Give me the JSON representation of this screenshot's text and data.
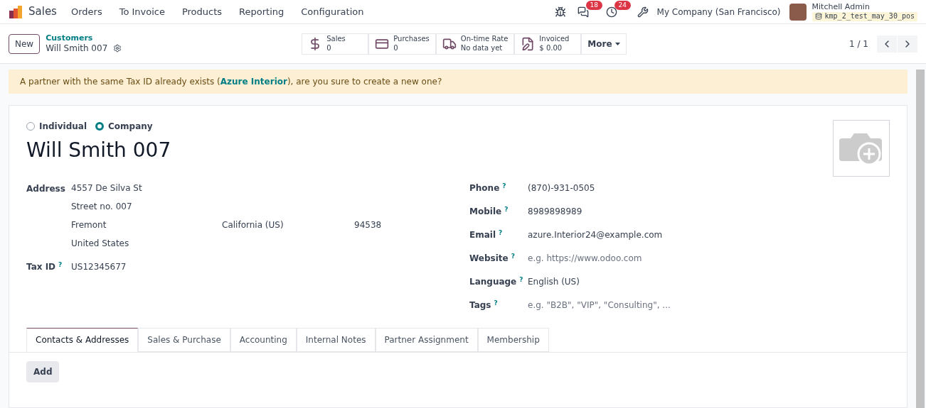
{
  "navbar": {
    "app": "Sales",
    "menu": [
      "Orders",
      "To Invoice",
      "Products",
      "Reporting",
      "Configuration"
    ],
    "messages_count": "18",
    "activities_count": "24",
    "company": "My Company (San Francisco)",
    "user": "Mitchell Admin",
    "database": "kmp_2_test_may_30_pos"
  },
  "control_panel": {
    "new_button": "New",
    "breadcrumb": "Customers",
    "record": "Will Smith 007",
    "pager": "1 / 1",
    "stat_buttons": [
      {
        "kind": "dollar",
        "label": "Sales",
        "value": "0"
      },
      {
        "kind": "card",
        "label": "Purchases",
        "value": "0"
      },
      {
        "kind": "truck",
        "label": "On-time Rate",
        "value": "No data yet"
      },
      {
        "kind": "invoice",
        "label": "Invoiced",
        "value": "$ 0.00"
      }
    ],
    "more_button": "More"
  },
  "warning": {
    "before": "A partner with the same Tax ID already exists (",
    "link": "Azure Interior",
    "after": "), are you sure to create a new one?"
  },
  "form": {
    "company_type": [
      {
        "label": "Individual",
        "selected": false
      },
      {
        "label": "Company",
        "selected": true
      }
    ],
    "name": "Will Smith 007",
    "address": {
      "label": "Address",
      "street": "4557 De Silva St",
      "street2": "Street no. 007",
      "city": "Fremont",
      "state": "California (US)",
      "zip": "94538",
      "country": "United States"
    },
    "tax_id": {
      "label": "Tax ID",
      "help": "?",
      "value": "US12345677"
    },
    "right_fields": [
      {
        "label": "Phone",
        "help": "?",
        "value": "(870)-931-0505"
      },
      {
        "label": "Mobile",
        "help": "?",
        "value": "8989898989"
      },
      {
        "label": "Email",
        "help": "?",
        "value": "azure.Interior24@example.com"
      },
      {
        "label": "Website",
        "help": "?",
        "placeholder": "e.g. https://www.odoo.com"
      },
      {
        "label": "Language",
        "help": "?",
        "value": "English (US)"
      },
      {
        "label": "Tags",
        "help": "?",
        "placeholder": "e.g. \"B2B\", \"VIP\", \"Consulting\", ..."
      }
    ],
    "tabs": [
      {
        "label": "Contacts & Addresses",
        "selected": true
      },
      {
        "label": "Sales & Purchase",
        "selected": false
      },
      {
        "label": "Accounting",
        "selected": false
      },
      {
        "label": "Internal Notes",
        "selected": false
      },
      {
        "label": "Partner Assignment",
        "selected": false
      },
      {
        "label": "Membership",
        "selected": false
      }
    ],
    "add_button": "Add"
  }
}
